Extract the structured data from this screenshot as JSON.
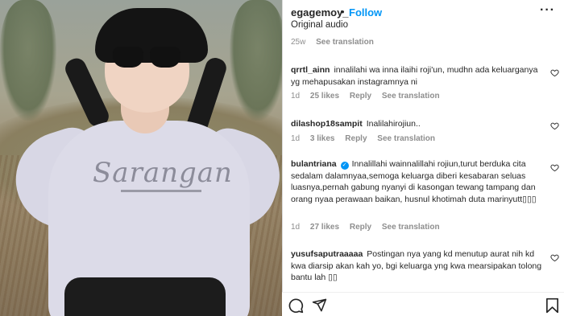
{
  "header": {
    "username": "egagemoy_",
    "separator": "•",
    "follow_label": "Follow",
    "audio_label": "Original audio",
    "more_label": "···"
  },
  "top_meta": {
    "time": "25w",
    "see_translation": "See translation"
  },
  "comments": [
    {
      "user": "qrrtl_ainn",
      "text": "innalilahi wa inna ilaihi roji'un, mudhn ada keluarganya yg mehapusakan instagramnya ni",
      "time": "1d",
      "likes": "25 likes",
      "reply": "Reply",
      "see_translation": "See translation"
    },
    {
      "user": "dilashop18sampit",
      "text": "Inalilahirojiun..",
      "time": "1d",
      "likes": "3 likes",
      "reply": "Reply",
      "see_translation": "See translation"
    },
    {
      "user": "bulantriana",
      "verified": true,
      "text": "Innalillahi wainnalillahi rojiun,turut berduka cita sedalam dalamnyaa,semoga keluarga diberi kesabaran seluas luasnya,pernah gabung nyanyi di kasongan tewang tampang dan orang nyaa perawaan baikan, husnul khotimah duta marinyutt▯▯▯",
      "time": "1d",
      "likes": "27 likes",
      "reply": "Reply",
      "see_translation": "See translation"
    },
    {
      "user": "yusufsaputraaaaa",
      "text": "Postingan nya yang kd menutup aurat nih kd kwa diarsip akan kah yo, bgi keluarga yng kwa mearsipakan tolong bantu lah ▯▯"
    }
  ],
  "photo": {
    "shirt_print": "Sarangan"
  },
  "icons": {
    "heart": "heart-icon",
    "comment": "comment-icon",
    "share": "share-icon",
    "save": "bookmark-icon",
    "verified": "verified-badge-icon"
  },
  "colors": {
    "link_blue": "#0095f6",
    "muted": "#8e8e8e",
    "text": "#262626"
  }
}
